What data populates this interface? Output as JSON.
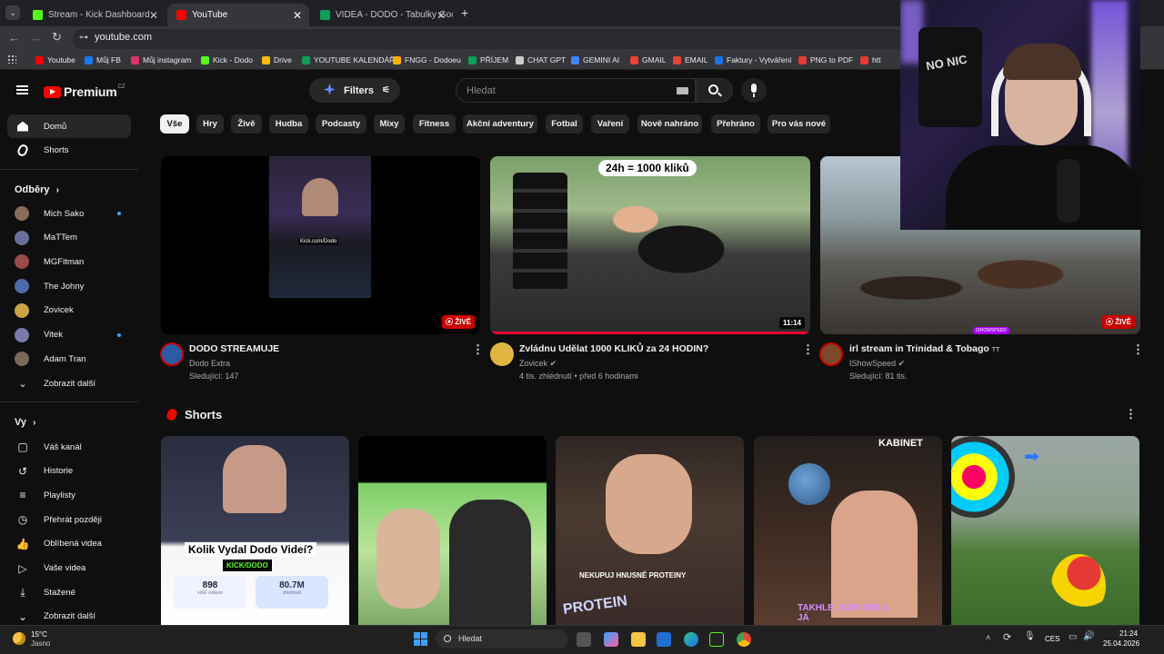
{
  "browser": {
    "tabs": [
      {
        "title": "Stream - Kick Dashboard",
        "color": "#53fc18"
      },
      {
        "title": "YouTube",
        "color": "#ff0000"
      },
      {
        "title": "VIDEA - DODO - Tabulky Googl",
        "color": "#0f9d58"
      }
    ],
    "new_tab": "+",
    "url": "youtube.com",
    "bookmarks": [
      {
        "label": "Youtube",
        "color": "#ff0000"
      },
      {
        "label": "Můj FB",
        "color": "#1877f2"
      },
      {
        "label": "Můj instagram",
        "color": "#e1306c"
      },
      {
        "label": "Kick - Dodo",
        "color": "#53fc18"
      },
      {
        "label": "Drive",
        "color": "#fbbc04"
      },
      {
        "label": "YOUTUBE KALENDÁŘ",
        "color": "#0f9d58"
      },
      {
        "label": "FNGG - Dodoeu",
        "color": "#f4b400"
      },
      {
        "label": "PŘÍJEM",
        "color": "#0f9d58"
      },
      {
        "label": "CHAT GPT",
        "color": "#cccccc"
      },
      {
        "label": "GEMINI AI",
        "color": "#4285f4"
      },
      {
        "label": "GMAIL",
        "color": "#ea4335"
      },
      {
        "label": "EMAIL",
        "color": "#ea4335"
      },
      {
        "label": "Faktury - Vytváření",
        "color": "#1a73e8"
      },
      {
        "label": "PNG to PDF",
        "color": "#e53935"
      },
      {
        "label": "htt",
        "color": "#e53935"
      }
    ]
  },
  "yt": {
    "logo": "Premium",
    "logo_region": "CZ",
    "filters_label": "Filters",
    "search_placeholder": "Hledat",
    "chips": [
      "Vše",
      "Hry",
      "Živě",
      "Hudba",
      "Podcasty",
      "Mixy",
      "Fitness",
      "Akční adventury",
      "Fotbal",
      "Vaření",
      "Nově nahráno",
      "Přehráno",
      "Pro vás nové"
    ],
    "sidebar": {
      "main": [
        {
          "label": "Domů",
          "icon": "home-icon"
        },
        {
          "label": "Shorts",
          "icon": "shorts-icon"
        }
      ],
      "subs_title": "Odběry",
      "subs": [
        {
          "label": "Mich Sako",
          "color": "#8a6a5a",
          "dot": true
        },
        {
          "label": "MaTTem",
          "color": "#6a6f9a",
          "dot": false
        },
        {
          "label": "MGFitman",
          "color": "#9a4a4a",
          "dot": false
        },
        {
          "label": "The Johny",
          "color": "#4a6aaa",
          "dot": false
        },
        {
          "label": "Zovicek",
          "color": "#caa540",
          "dot": false
        },
        {
          "label": "Vitek",
          "color": "#7a7aaa",
          "dot": true
        },
        {
          "label": "Adam Tran",
          "color": "#7a6a5a",
          "dot": false
        }
      ],
      "show_more": "Zobrazit další",
      "you_title": "Vy",
      "you": [
        {
          "label": "Váš kanál",
          "icon": "channel-icon"
        },
        {
          "label": "Historie",
          "icon": "history-icon"
        },
        {
          "label": "Playlisty",
          "icon": "playlist-icon"
        },
        {
          "label": "Přehrát později",
          "icon": "clock-icon"
        },
        {
          "label": "Oblíbená videa",
          "icon": "like-icon"
        },
        {
          "label": "Vaše videa",
          "icon": "video-icon"
        },
        {
          "label": "Stažené",
          "icon": "download-icon"
        },
        {
          "label": "Zobrazit další",
          "icon": "chevron-down-icon"
        }
      ]
    },
    "videos": [
      {
        "title": "DODO STREAMUJE",
        "channel": "Dodo Extra",
        "meta": "Sledující: 147",
        "badge": "ŽIVĚ",
        "overlay": "Kick.com/Dodo"
      },
      {
        "title": "Zvládnu Udělat 1000 KLIKŮ za 24 HODIN?",
        "channel": "Zovicek",
        "meta": "4 tis. zhlédnutí • před 6 hodinami",
        "badge": "11:14",
        "overlay": "24h = 1000 kliků"
      },
      {
        "title": "irl stream in Trinidad & Tobago",
        "title_suffix": "TT",
        "channel": "IShowSpeed",
        "meta": "Sledující: 81 tis.",
        "badge": "ŽIVĚ",
        "overlay": "ISHOWSPEED"
      }
    ],
    "shorts_title": "Shorts",
    "shorts": [
      {
        "overlay": "Kolik Vydal Dodo Videí?",
        "sub": "KICK/DODO",
        "stats": [
          "898",
          "80.7M"
        ],
        "stat_labels": [
          "videí celkem",
          "zhlédnutí"
        ]
      },
      {
        "overlay": ""
      },
      {
        "overlay": "NEKUPUJ HNUSNÉ PROTEINY",
        "brand": "PROTEIN"
      },
      {
        "overlay": "TAKHLE JSEM MĚLA JÁ",
        "brand": "KABINET"
      },
      {
        "overlay": ""
      }
    ]
  },
  "taskbar": {
    "temp": "15°C",
    "weather": "Jasno",
    "search": "Hledat",
    "lang": "CES",
    "time": "21:24",
    "date": "25.04.2026"
  },
  "webcam": {
    "shirt_text": "NO NIC"
  }
}
